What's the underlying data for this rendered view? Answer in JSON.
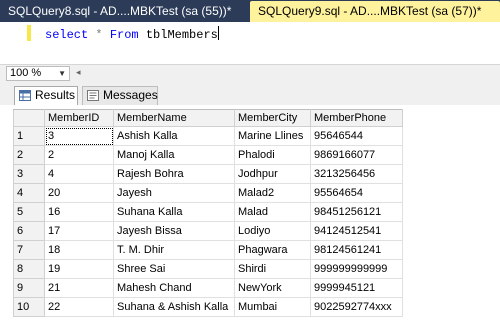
{
  "tabs": [
    {
      "label": "SQLQuery8.sql - AD....MBKTest (sa (55))*"
    },
    {
      "label": "SQLQuery9.sql - AD....MBKTest (sa (57))*"
    }
  ],
  "editor": {
    "keyword_select": "select",
    "star": "*",
    "keyword_from": "From",
    "table": "tblMembers"
  },
  "zoom": {
    "value": "100 %"
  },
  "result_tabs": {
    "results": "Results",
    "messages": "Messages"
  },
  "grid": {
    "columns": [
      "MemberID",
      "MemberName",
      "MemberCity",
      "MemberPhone"
    ],
    "rows": [
      {
        "n": "1",
        "id": "3",
        "name": "Ashish Kalla",
        "city": "Marine Llines",
        "phone": "95646544"
      },
      {
        "n": "2",
        "id": "2",
        "name": "Manoj Kalla",
        "city": "Phalodi",
        "phone": "9869166077"
      },
      {
        "n": "3",
        "id": "4",
        "name": "Rajesh Bohra",
        "city": "Jodhpur",
        "phone": "3213256456"
      },
      {
        "n": "4",
        "id": "20",
        "name": "Jayesh",
        "city": "Malad2",
        "phone": "95564654"
      },
      {
        "n": "5",
        "id": "16",
        "name": "Suhana Kalla",
        "city": "Malad",
        "phone": "98451256121"
      },
      {
        "n": "6",
        "id": "17",
        "name": "Jayesh Bissa",
        "city": "Lodiyo",
        "phone": "94124512541"
      },
      {
        "n": "7",
        "id": "18",
        "name": "T. M. Dhir",
        "city": "Phagwara",
        "phone": "98124561241"
      },
      {
        "n": "8",
        "id": "19",
        "name": "Shree Sai",
        "city": "Shirdi",
        "phone": "999999999999"
      },
      {
        "n": "9",
        "id": "21",
        "name": "Mahesh Chand",
        "city": "NewYork",
        "phone": "9999945121"
      },
      {
        "n": "10",
        "id": "22",
        "name": "Suhana & Ashish Kalla",
        "city": "Mumbai",
        "phone": "9022592774xxx"
      }
    ]
  },
  "colors": {
    "tabstrip_bg": "#2b3b58",
    "active_tab_bg": "#fff29d",
    "keyword": "#0000ff"
  }
}
